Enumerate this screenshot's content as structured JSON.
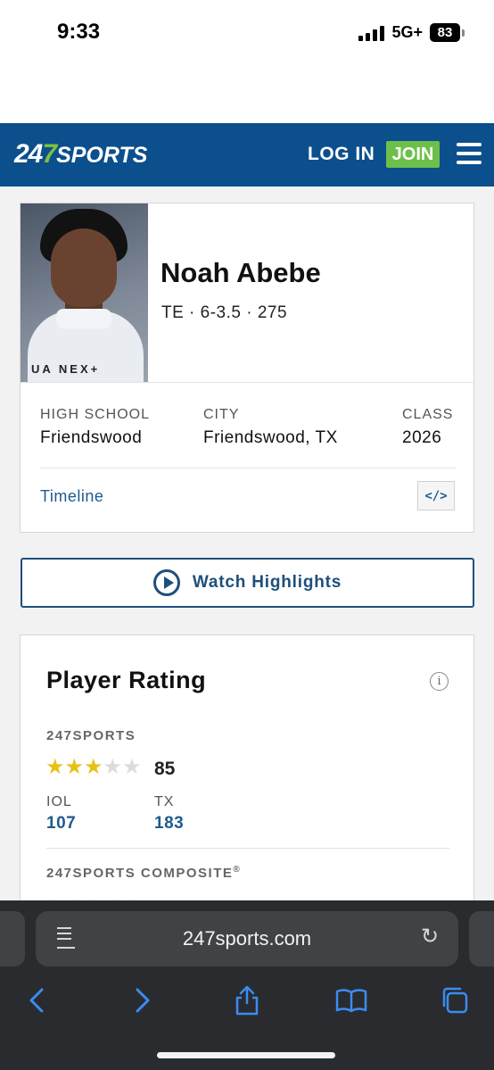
{
  "status_bar": {
    "time": "9:33",
    "network": "5G+",
    "battery": "83"
  },
  "header": {
    "logo_num_a": "24",
    "logo_num_b": "7",
    "logo_word": "SPORTS",
    "login_label": "LOG IN",
    "join_label": "JOIN",
    "colors": {
      "brand_blue": "#0b4f8c",
      "join_green": "#6cc04a"
    }
  },
  "player": {
    "name": "Noah Abebe",
    "meta": "TE · 6-3.5 · 275",
    "photo_brand": "UA NEX+",
    "high_school_label": "HIGH SCHOOL",
    "high_school": "Friendswood",
    "city_label": "CITY",
    "city": "Friendswood, TX",
    "class_label": "CLASS",
    "class": "2026",
    "timeline_label": "Timeline",
    "embed_icon": "</>"
  },
  "highlights": {
    "label": "Watch Highlights"
  },
  "rating": {
    "title": "Player Rating",
    "info_icon": "i",
    "sports247_label": "247SPORTS",
    "stars_filled": 3,
    "stars_total": 5,
    "score": "85",
    "rank1_label": "IOL",
    "rank1_value": "107",
    "rank2_label": "TX",
    "rank2_value": "183",
    "composite_label": "247SPORTS COMPOSITE",
    "composite_mark": "®"
  },
  "browser": {
    "url": "247sports.com"
  }
}
